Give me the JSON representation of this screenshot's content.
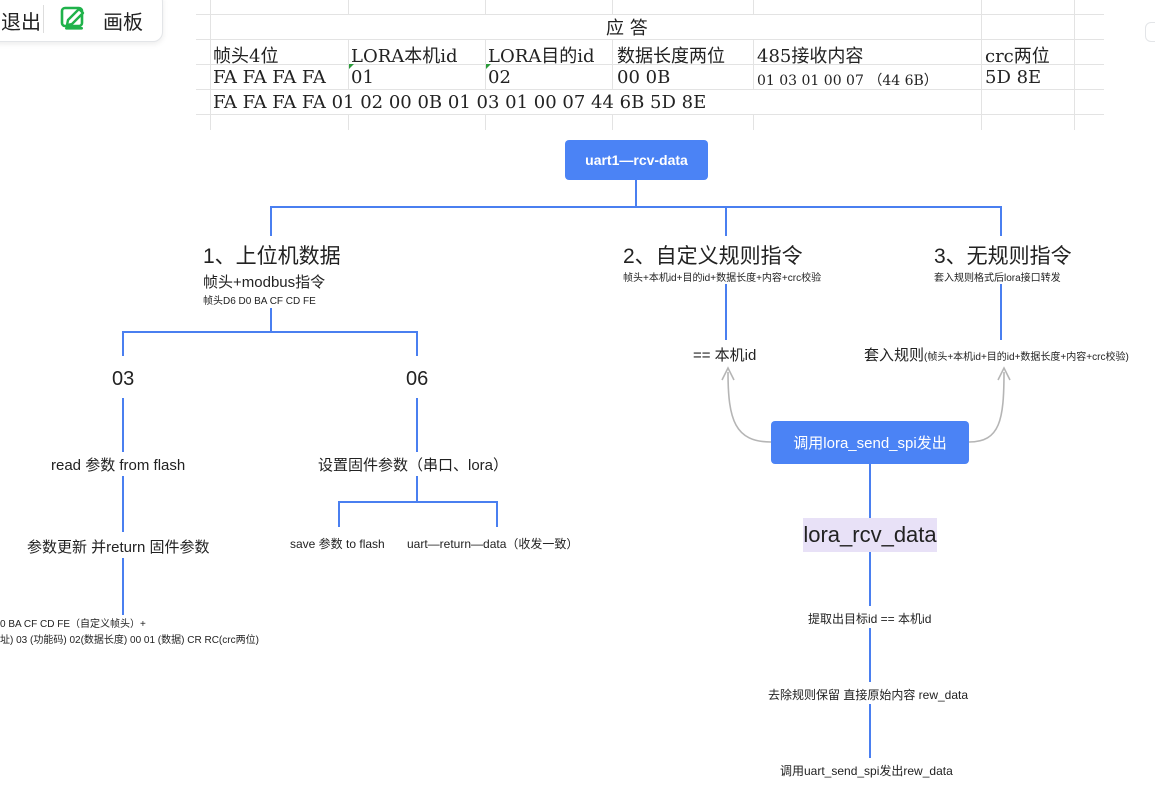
{
  "toolbar": {
    "exit_label": "退出",
    "board_label": "画板",
    "exit_visible": "退出",
    "exit_visible_text": "退出",
    "exit_shown": "退出"
  },
  "sheet": {
    "title": "应   答",
    "headers": [
      "帧头4位",
      "LORA本机id",
      "LORA目的id",
      "数据长度两位",
      "485接收内容",
      "crc两位"
    ],
    "row1": [
      "FA FA FA FA",
      "01",
      "02",
      "00 0B",
      "01 03 01 00 07 （44 6B）",
      "5D 8E"
    ],
    "row2": "FA FA FA FA 01 02 00 0B 01 03 01 00 07 44 6B 5D 8E"
  },
  "flow": {
    "root": "uart1—rcv-data",
    "b1_title": "1、上位机数据",
    "b1_sub": "帧头+modbus指令",
    "b1_note": "帧头D6 D0 BA CF CD FE",
    "b2_title": "2、自定义规则指令",
    "b2_sub": "帧头+本机id+目的id+数据长度+内容+crc校验",
    "b3_title": "3、无规则指令",
    "b3_sub": "套入规则格式后lora接口转发",
    "code03": "03",
    "code06": "06",
    "read_flash": "read 参数 from flash",
    "update_params": "参数更新 并return 固件参数",
    "frame_line1": "0 BA CF CD FE（自定义帧头）+",
    "frame_line2": "址) 03 (功能码) 02(数据长度) 00 01 (数据) CR RC(crc两位)",
    "set_params": "设置固件参数（串口、lora）",
    "save_flash": "save 参数 to flash",
    "uart_return": "uart—return—data（收发一致）",
    "eq_local": "== 本机id",
    "wrap_rule_main": "套入规则",
    "wrap_rule_detail": "(帧头+本机id+目的id+数据长度+内容+crc校验)",
    "lora_send": "调用lora_send_spi发出",
    "lora_rcv": "lora_rcv_data",
    "extract": "提取出目标id == 本机id",
    "strip": "去除规则保留 直接原始内容 rew_data",
    "uart_send": "调用uart_send_spi发出rew_data"
  },
  "colors": {
    "accent": "#4b83f5",
    "line": "#4a7ff0",
    "highlight": "#e8e1f7",
    "toolbar_icon": "#1fb24a"
  }
}
